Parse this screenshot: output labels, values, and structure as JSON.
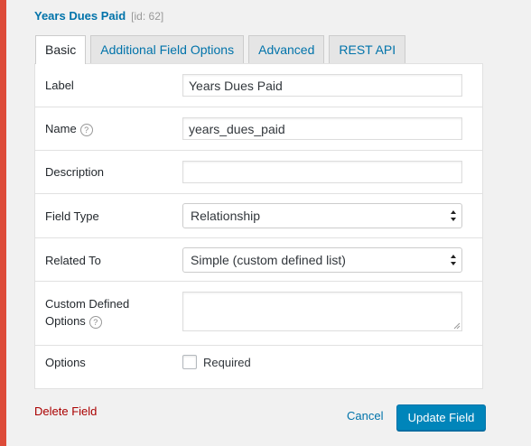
{
  "field": {
    "title": "Years Dues Paid",
    "id_label": "[id: 62]"
  },
  "tabs": [
    {
      "label": "Basic",
      "active": true
    },
    {
      "label": "Additional Field Options",
      "active": false
    },
    {
      "label": "Advanced",
      "active": false
    },
    {
      "label": "REST API",
      "active": false
    }
  ],
  "form": {
    "label": {
      "label": "Label",
      "value": "Years Dues Paid"
    },
    "name": {
      "label": "Name",
      "value": "years_dues_paid",
      "help": "?"
    },
    "description": {
      "label": "Description",
      "value": ""
    },
    "field_type": {
      "label": "Field Type",
      "value": "Relationship"
    },
    "related_to": {
      "label": "Related To",
      "value": "Simple (custom defined list)"
    },
    "custom_options": {
      "label_line1": "Custom Defined",
      "label_line2": "Options",
      "help": "?",
      "value": ""
    },
    "options": {
      "label": "Options",
      "required_label": "Required",
      "required_checked": false
    }
  },
  "actions": {
    "delete": "Delete Field",
    "cancel": "Cancel",
    "update": "Update Field"
  },
  "colors": {
    "accent": "#dd4b39",
    "link": "#0073aa",
    "primary_button": "#0085ba",
    "delete": "#aa0000"
  }
}
